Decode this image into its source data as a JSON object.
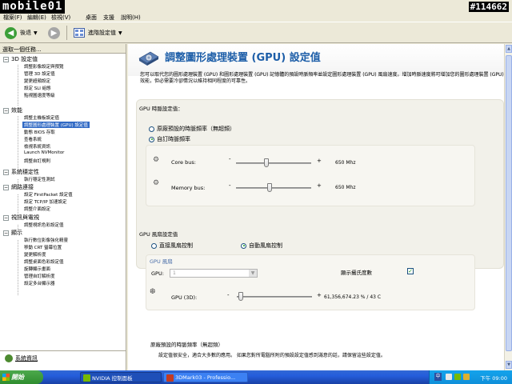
{
  "branding": {
    "logo_text": "mobile01",
    "screenshot_id": "#114662"
  },
  "menubar": {
    "items": [
      {
        "id": "file",
        "label": "檔案(F)"
      },
      {
        "id": "edit",
        "label": "編輯(E)"
      },
      {
        "id": "view",
        "label": "檢視(V)"
      },
      {
        "id": "desktop",
        "label": "桌面"
      },
      {
        "id": "support",
        "label": "支援"
      },
      {
        "id": "help",
        "label": "說明(H)"
      }
    ]
  },
  "toolbar": {
    "back_label": "後退",
    "view_label": "進階設定值"
  },
  "leftpane": {
    "task_header": "選取一個任務...",
    "categories": [
      {
        "label": "3D 設定值",
        "items": [
          "調整影像設定與預覽",
          "管理 3D 設定值",
          "變更超頻設定",
          "設定 SLI 組態",
          "點視圖速度等級"
        ]
      },
      {
        "label": "效能",
        "items": [
          "調整主機板設定值",
          "調整圖形處理裝置 (GPU) 設定值",
          "動態 BIOS 存取",
          "查看系統",
          "檢視系統資訊",
          "Launch NVMonitor",
          "調整自訂規則"
        ]
      },
      {
        "label": "系統穩定性",
        "items": [
          "執行穩定性測試"
        ]
      },
      {
        "label": "網路連接",
        "items": [
          "設定 FirstPacket 設定值",
          "設定 TCP/IP 加速設定",
          "調整介面設定"
        ]
      },
      {
        "label": "視訊與電視",
        "items": [
          "調整視訊色彩設定值"
        ]
      },
      {
        "label": "顯示",
        "items": [
          "執行數位影像強化精靈",
          "移動 CRT 螢幕位置",
          "變更解析度",
          "調整桌面色彩設定值",
          "旋轉顯示畫面",
          "管理自訂解析度",
          "設定多台顯示器"
        ]
      }
    ],
    "selected_item": "調整圖形處理裝置 (GPU) 設定值",
    "system_info_link": "系統資訊"
  },
  "content": {
    "page_title": "調整圖形處理裝置 (GPU) 設定值",
    "description": "您可以取代您的圖形處理裝置 (GPU) 和圖形處理裝置 (GPU) 記憶體的預設時脈頻率並設定圖形處理裝置 (GPU) 風扇速度。增加時脈速度將可增加您的圖形處理裝置 (GPU) 效能，但必需要冷卻情況以維持相同程度的可靠性。",
    "clock_section": {
      "title": "GPU 時脈設定值：",
      "radio_default": "原廠預設的時脈頻率（無超頻）",
      "radio_custom": "自訂時脈頻率",
      "selected": "custom",
      "core_label": "Core bus:",
      "core_value": "650 Mhz",
      "core_level": 0.4,
      "memory_label": "Memory bus:",
      "memory_value": "650 Mhz",
      "memory_level": 0.45,
      "minus": "-",
      "plus": "+"
    },
    "fan_section": {
      "title": "GPU 風扇設定值",
      "radio_direct": "直接風扇控制",
      "radio_auto": "自動風扇控制",
      "selected": "auto",
      "sub_title": "GPU 風扇",
      "gpu_label": "GPU:",
      "gpu_dropdown_value": "1",
      "show_temp_label": "顯示攝氏度數",
      "show_temp_checked": true,
      "gpu3d_label": "GPU (3D):",
      "gpu3d_value": "61,356,674.23 % / 43 C",
      "gpu3d_level": 0.05,
      "minus": "-",
      "plus": "+"
    },
    "bottom": {
      "title": "原廠預設的時脈頻率（無超頻）",
      "desc": "設定值很安全，適合大多數的應用。 如果您對所電腦所附的預設設定值感到滿意的話，請保留這些設定值。"
    }
  },
  "taskbar": {
    "start_label": "開始",
    "tasks": [
      {
        "label": "NVIDIA 控制面板",
        "active": true
      },
      {
        "label": "3DMark03 - Professio...",
        "active": false
      }
    ],
    "lang": "中",
    "clock": "下午 09:00"
  }
}
